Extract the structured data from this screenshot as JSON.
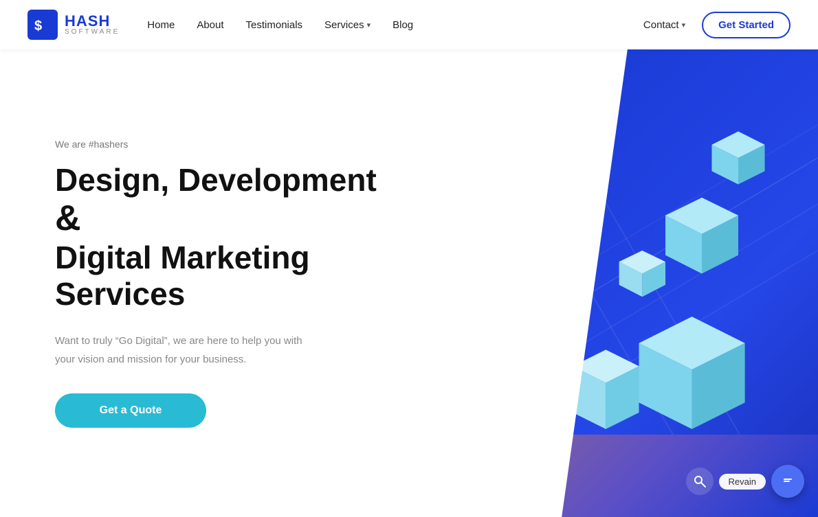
{
  "logo": {
    "icon_text": "$",
    "hash": "HASH",
    "software": "SOFTWARE"
  },
  "nav": {
    "links": [
      {
        "label": "Home",
        "dropdown": false
      },
      {
        "label": "About",
        "dropdown": false
      },
      {
        "label": "Testimonials",
        "dropdown": false
      },
      {
        "label": "Services",
        "dropdown": true
      },
      {
        "label": "Blog",
        "dropdown": false
      }
    ],
    "contact": "Contact",
    "get_started": "Get Started"
  },
  "hero": {
    "tagline": "We are #hashers",
    "title_line1": "Design, Development",
    "title_amp": "&",
    "title_line2": "Digital Marketing",
    "title_line3": "Services",
    "description": "Want to truly “Go Digital”, we are here to help you with your vision and mission for your business.",
    "cta": "Get a Quote"
  },
  "chat": {
    "label": "Revain",
    "icon": "💬"
  }
}
